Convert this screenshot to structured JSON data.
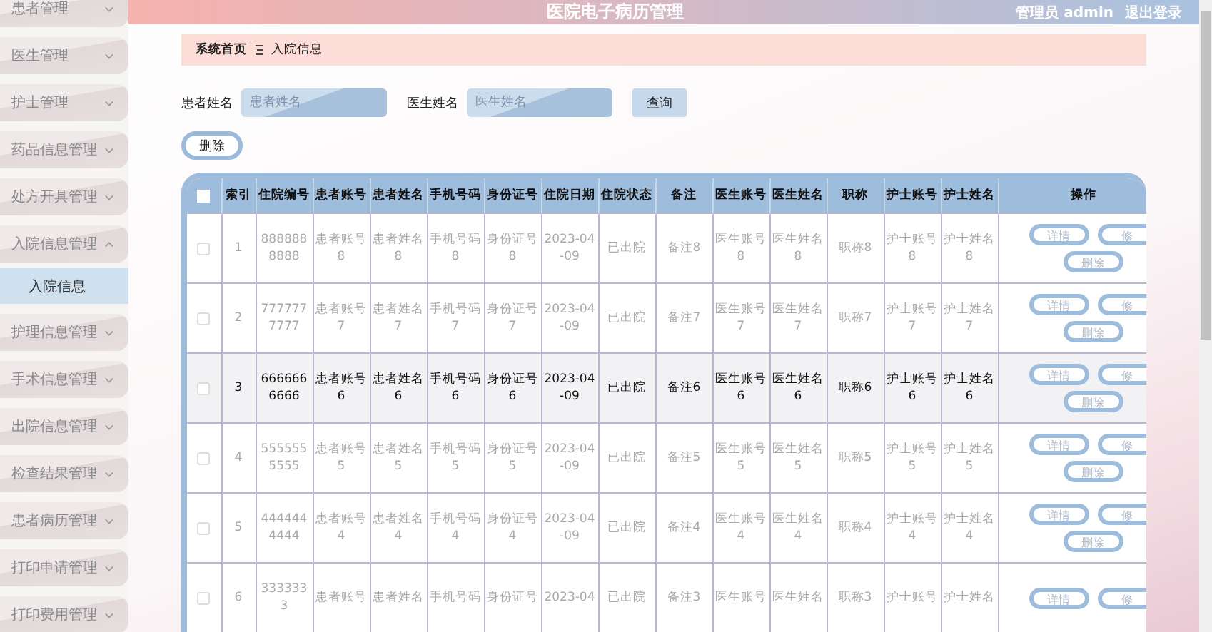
{
  "header": {
    "title": "医院电子病历管理",
    "user": "管理员 admin",
    "logout": "退出登录"
  },
  "sidebar": {
    "items": [
      {
        "label": "患者管理",
        "expanded": false
      },
      {
        "label": "医生管理",
        "expanded": false
      },
      {
        "label": "护士管理",
        "expanded": false
      },
      {
        "label": "药品信息管理",
        "expanded": false
      },
      {
        "label": "处方开具管理",
        "expanded": false
      },
      {
        "label": "入院信息管理",
        "expanded": true,
        "children": [
          {
            "label": "入院信息",
            "selected": true
          }
        ]
      },
      {
        "label": "护理信息管理",
        "expanded": false
      },
      {
        "label": "手术信息管理",
        "expanded": false
      },
      {
        "label": "出院信息管理",
        "expanded": false
      },
      {
        "label": "检查结果管理",
        "expanded": false
      },
      {
        "label": "患者病历管理",
        "expanded": false
      },
      {
        "label": "打印申请管理",
        "expanded": false
      },
      {
        "label": "打印费用管理",
        "expanded": false
      }
    ]
  },
  "breadcrumb": {
    "home": "系统首页",
    "current": "入院信息"
  },
  "search": {
    "fields": [
      {
        "label": "患者姓名",
        "placeholder": "患者姓名"
      },
      {
        "label": "医生姓名",
        "placeholder": "医生姓名"
      }
    ],
    "button": "查询"
  },
  "delete_button": "删除",
  "table": {
    "all_checked": false,
    "columns": [
      "索引",
      "住院编号",
      "患者账号",
      "患者姓名",
      "手机号码",
      "身份证号",
      "住院日期",
      "住院状态",
      "备注",
      "医生账号",
      "医生姓名",
      "职称",
      "护士账号",
      "护士姓名",
      "操作"
    ],
    "rows": [
      {
        "checked": false,
        "highlighted": false,
        "cells": [
          "1",
          "8888888888",
          "患者账号8",
          "患者姓名8",
          "手机号码8",
          "身份证号8",
          "2023-04-09",
          "已出院",
          "备注8",
          "医生账号8",
          "医生姓名8",
          "职称8",
          "护士账号8",
          "护士姓名8"
        ],
        "actions": [
          "详情",
          "修",
          "删除"
        ]
      },
      {
        "checked": false,
        "highlighted": false,
        "cells": [
          "2",
          "7777777777",
          "患者账号7",
          "患者姓名7",
          "手机号码7",
          "身份证号7",
          "2023-04-09",
          "已出院",
          "备注7",
          "医生账号7",
          "医生姓名7",
          "职称7",
          "护士账号7",
          "护士姓名7"
        ],
        "actions": [
          "详情",
          "修",
          "删除"
        ]
      },
      {
        "checked": false,
        "highlighted": true,
        "cells": [
          "3",
          "6666666666",
          "患者账号6",
          "患者姓名6",
          "手机号码6",
          "身份证号6",
          "2023-04-09",
          "已出院",
          "备注6",
          "医生账号6",
          "医生姓名6",
          "职称6",
          "护士账号6",
          "护士姓名6"
        ],
        "actions": [
          "详情",
          "修",
          "删除"
        ]
      },
      {
        "checked": false,
        "highlighted": false,
        "cells": [
          "4",
          "5555555555",
          "患者账号5",
          "患者姓名5",
          "手机号码5",
          "身份证号5",
          "2023-04-09",
          "已出院",
          "备注5",
          "医生账号5",
          "医生姓名5",
          "职称5",
          "护士账号5",
          "护士姓名5"
        ],
        "actions": [
          "详情",
          "修",
          "删除"
        ]
      },
      {
        "checked": false,
        "highlighted": false,
        "cells": [
          "5",
          "4444444444",
          "患者账号4",
          "患者姓名4",
          "手机号码4",
          "身份证号4",
          "2023-04-09",
          "已出院",
          "备注4",
          "医生账号4",
          "医生姓名4",
          "职称4",
          "护士账号4",
          "护士姓名4"
        ],
        "actions": [
          "详情",
          "修",
          "删除"
        ]
      },
      {
        "checked": false,
        "highlighted": false,
        "cells": [
          "6",
          "3333333",
          "患者账号",
          "患者姓名",
          "手机号码",
          "身份证号",
          "2023-04",
          "已出院",
          "备注3",
          "医生账号",
          "医生姓名",
          "职称3",
          "护士账号",
          "护士姓名"
        ],
        "actions": [
          "详情",
          "修"
        ]
      }
    ]
  }
}
